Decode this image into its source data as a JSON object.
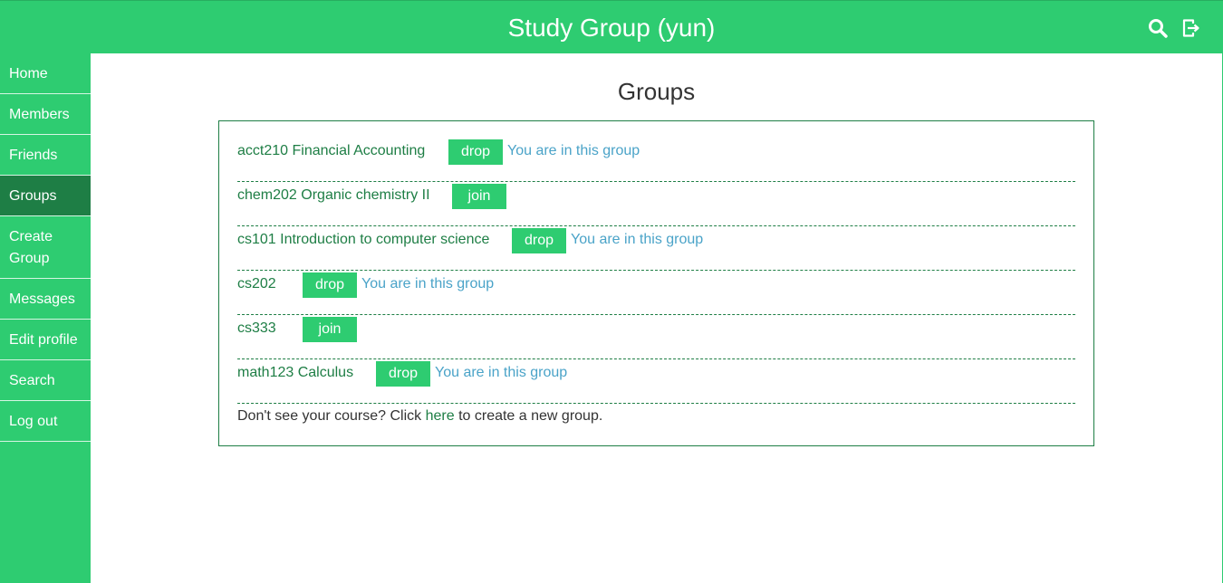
{
  "app": {
    "title": "Study Group (yun)",
    "icons": [
      "search-icon",
      "logout-icon"
    ]
  },
  "sidebar": {
    "items": [
      {
        "label": "Home",
        "active": false
      },
      {
        "label": "Members",
        "active": false
      },
      {
        "label": "Friends",
        "active": false
      },
      {
        "label": "Groups",
        "active": true
      },
      {
        "label_line1": "Create",
        "label_line2": "Group",
        "active": false
      },
      {
        "label": "Messages",
        "active": false
      },
      {
        "label": "Edit profile",
        "active": false
      },
      {
        "label": "Search",
        "active": false
      },
      {
        "label": "Log out",
        "active": false
      }
    ]
  },
  "main": {
    "title": "Groups",
    "groups": [
      {
        "course": "acct210 Financial Accounting",
        "action": "drop",
        "status": "You are in this group"
      },
      {
        "course": "chem202 Organic chemistry II",
        "action": "join",
        "status": ""
      },
      {
        "course": "cs101 Introduction to computer science",
        "action": "drop",
        "status": "You are in this group"
      },
      {
        "course": "cs202",
        "action": "drop",
        "status": "You are in this group"
      },
      {
        "course": "cs333",
        "action": "join",
        "status": ""
      },
      {
        "course": "math123 Calculus",
        "action": "drop",
        "status": "You are in this group"
      }
    ],
    "footer": {
      "before": "Don't see your course? Click ",
      "link": "here",
      "after": " to create a new group."
    }
  },
  "colors": {
    "accent": "#2ecc71",
    "accent_dark": "#1e7e45",
    "status_text": "#4aa3c8"
  }
}
